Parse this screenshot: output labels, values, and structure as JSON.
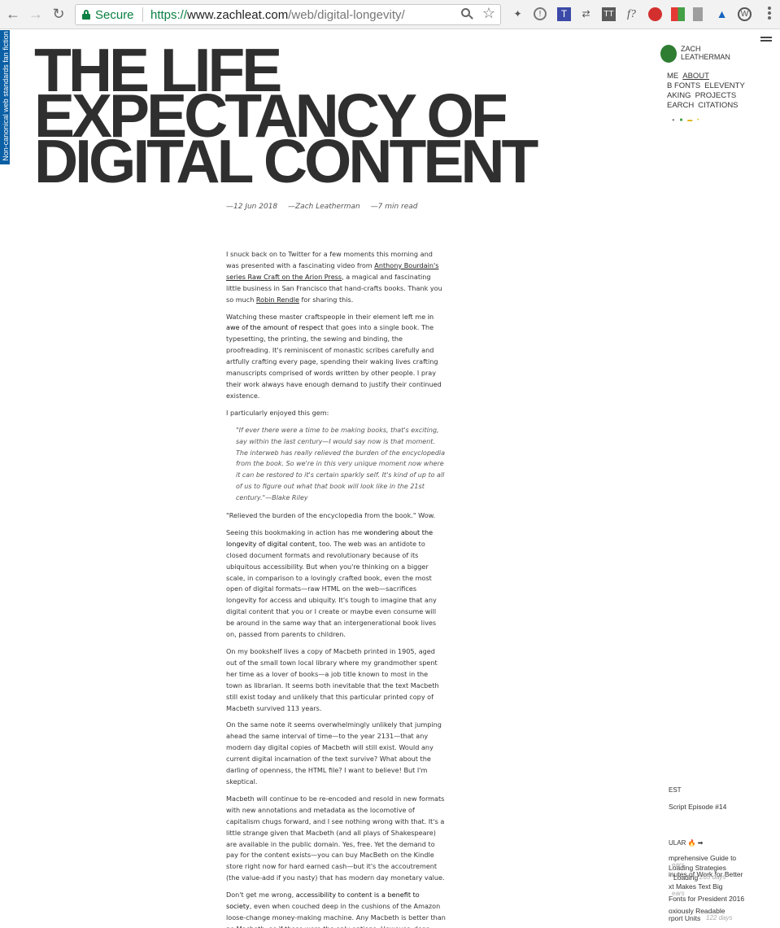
{
  "browser": {
    "secure_label": "Secure",
    "url_scheme": "https://",
    "url_host": "www.zachleat.com",
    "url_path": "/web/digital-longevity/",
    "extension_icons": [
      "pin",
      "info",
      "T",
      "shuffle",
      "TT",
      "f?",
      "red",
      "grid",
      "green",
      "bars",
      "triangle",
      "W"
    ]
  },
  "ribbon": {
    "text": "Non-canonical web standards fan fiction"
  },
  "site": {
    "name_line1": "ZACH",
    "name_line2": "LEATHERMAN",
    "nav_row1": [
      "ME",
      "ABOUT"
    ],
    "nav_row2": [
      "B FONTS",
      "ELEVENTY"
    ],
    "nav_row3": [
      "AKING",
      "PROJECTS"
    ],
    "nav_row4": [
      "EARCH",
      "CITATIONS"
    ]
  },
  "article": {
    "title_line1": "THE LIFE",
    "title_line2": "EXPECTANCY OF",
    "title_line3": "DIGITAL CONTENT",
    "date": "—12 Jun 2018",
    "author": "—Zach Leatherman",
    "read_time": "—7 min read",
    "p1_a": "I snuck back on to Twitter for a few moments this morning and was presented with a fascinating video from ",
    "p1_link1": "Anthony Bourdain's series Raw Craft on the Arion Press",
    "p1_b": ", a magical and fascinating little business in San Francisco that hand-crafts books. Thank you so much ",
    "p1_link2": "Robin Rendle",
    "p1_c": " for sharing this.",
    "p2_a": "Watching these master craftspeople in their element left me ",
    "p2_strong": "in awe of the amount of respect",
    "p2_b": " that goes into a single book. The typesetting, the printing, the sewing and binding, the proofreading. It's reminiscent of monastic scribes carefully and artfully crafting every page, spending their waking lives crafting manuscripts comprised of words written by other people. I pray their work always have enough demand to justify their continued existence.",
    "p3": "I particularly enjoyed this gem:",
    "quote": "\"If ever there were a time to be making books, that's exciting, say within the last century—I would say now is that moment. The interweb has really relieved the burden of the encyclopedia from the book. So we're in this very unique moment now where it can be restored to it's certain sparkly self. It's kind of up to all of us to figure out what that book will look like in the 21st century.\"—Blake Riley",
    "p4": "\"Relieved the burden of the encyclopedia from the book.\" Wow.",
    "p5_a": "Seeing this bookmaking in action has me ",
    "p5_strong": "wondering about the longevity of digital content",
    "p5_b": ", too. The web was an antidote to closed document formats and revolutionary because of its ubiquitous accessibility. But when you're thinking on a bigger scale, in comparison to a lovingly crafted book, even the most open of digital formats—raw HTML on the web—sacrifices longevity for access and ubiquity. It's tough to imagine that any digital content that you or I create or maybe even consume will be around in the same way that an intergenerational book lives on, passed from parents to children.",
    "p6": "On my bookshelf lives a copy of Macbeth printed in 1905, aged out of the small town local library where my grandmother spent her time as a lover of books—a job title known to most in the town as librarian. It seems both inevitable that the text Macbeth still exist today and unlikely that this particular printed copy of Macbeth survived 113 years.",
    "p7": "On the same note it seems overwhelmingly unlikely that jumping ahead the same interval of time—to the year 2131—that any modern day digital copies of Macbeth will still exist. Would any current digital incarnation of the text survive? What about the darling of openness, the HTML file? I want to believe! But I'm skeptical.",
    "p8": "Macbeth will continue to be re-encoded and resold in new formats with new annotations and metadata as the locomotive of capitalism chugs forward, and I see nothing wrong with that. It's a little strange given that Macbeth (and all plays of Shakespeare) are available in the public domain. Yes, free. Yet the demand to pay for the content exists—you can buy MacBeth on the Kindle store right now for hard earned cash—but it's the accoutrement (the value-add if you nasty) that has modern day monetary value.",
    "p9_a": "Don't get me wrong, ",
    "p9_strong": "accessibility to content is a benefit to society",
    "p9_b": ", even when couched deep in the cushions of the Amazon loose-change money-making machine. Any Macbeth is better than no Macbeth, as if those were the only options. However, dear reader, you may already know that our options are not limited to those."
  },
  "sidebar": {
    "latest_head": "EST",
    "latest_item": "Script Episode #14",
    "popular_head": "ULAR 🔥 ➡",
    "popular_items": [
      "mprehensive Guide to",
      "Loading Strategies",
      "inutes of Work for Better",
      "Loading",
      "xt Makes Text Big",
      "Fonts for President 2016",
      "oxiously Readable",
      "rport Units"
    ],
    "ghost_1": "ears",
    "ghost_2": "263 days",
    "ghost_3": "ears",
    "ghost_4": "122 days"
  }
}
